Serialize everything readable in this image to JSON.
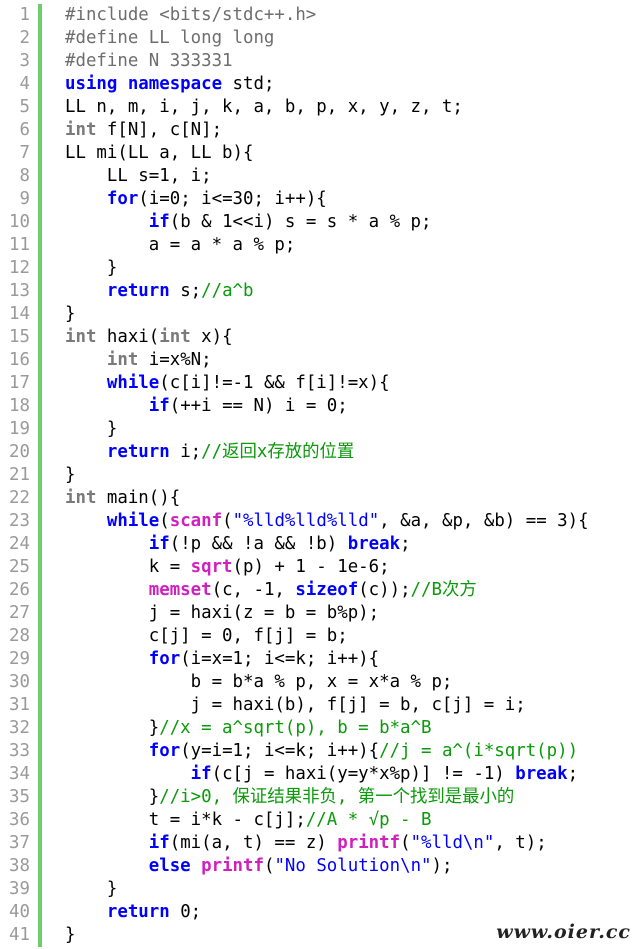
{
  "editor": {
    "lines": [
      {
        "n": "1",
        "segs": [
          {
            "t": "#include <bits/stdc++.h>",
            "c": "pp"
          }
        ]
      },
      {
        "n": "2",
        "segs": [
          {
            "t": "#define LL long long",
            "c": "pp"
          }
        ]
      },
      {
        "n": "3",
        "segs": [
          {
            "t": "#define N 333331",
            "c": "pp"
          }
        ]
      },
      {
        "n": "4",
        "segs": [
          {
            "t": "using namespace ",
            "c": "kw"
          },
          {
            "t": "std;",
            "c": "txt"
          }
        ]
      },
      {
        "n": "5",
        "segs": [
          {
            "t": "LL n, m, i, j, k, a, b, p, x, y, z, t;",
            "c": "txt"
          }
        ]
      },
      {
        "n": "6",
        "segs": [
          {
            "t": "int",
            "c": "ty"
          },
          {
            "t": " f[N], c[N];",
            "c": "txt"
          }
        ]
      },
      {
        "n": "7",
        "segs": [
          {
            "t": "LL mi(LL a, LL b){",
            "c": "txt"
          }
        ]
      },
      {
        "n": "8",
        "segs": [
          {
            "t": "    LL s=1, i;",
            "c": "txt"
          }
        ]
      },
      {
        "n": "9",
        "segs": [
          {
            "t": "    ",
            "c": "txt"
          },
          {
            "t": "for",
            "c": "kw"
          },
          {
            "t": "(i=0; i<=30; i++){",
            "c": "txt"
          }
        ]
      },
      {
        "n": "10",
        "segs": [
          {
            "t": "        ",
            "c": "txt"
          },
          {
            "t": "if",
            "c": "kw"
          },
          {
            "t": "(b & 1<<i) s = s * a % p;",
            "c": "txt"
          }
        ]
      },
      {
        "n": "11",
        "segs": [
          {
            "t": "        a = a * a % p;",
            "c": "txt"
          }
        ]
      },
      {
        "n": "12",
        "segs": [
          {
            "t": "    }",
            "c": "txt"
          }
        ]
      },
      {
        "n": "13",
        "segs": [
          {
            "t": "    ",
            "c": "txt"
          },
          {
            "t": "return",
            "c": "ret"
          },
          {
            "t": " s;",
            "c": "txt"
          },
          {
            "t": "//a^b",
            "c": "cm"
          }
        ]
      },
      {
        "n": "14",
        "segs": [
          {
            "t": "}",
            "c": "txt"
          }
        ]
      },
      {
        "n": "15",
        "segs": [
          {
            "t": "int",
            "c": "ty"
          },
          {
            "t": " haxi(",
            "c": "txt"
          },
          {
            "t": "int",
            "c": "ty"
          },
          {
            "t": " x){",
            "c": "txt"
          }
        ]
      },
      {
        "n": "16",
        "segs": [
          {
            "t": "    ",
            "c": "txt"
          },
          {
            "t": "int",
            "c": "ty"
          },
          {
            "t": " i=x%N;",
            "c": "txt"
          }
        ]
      },
      {
        "n": "17",
        "segs": [
          {
            "t": "    ",
            "c": "txt"
          },
          {
            "t": "while",
            "c": "kw"
          },
          {
            "t": "(c[i]!=-1 && f[i]!=x){",
            "c": "txt"
          }
        ]
      },
      {
        "n": "18",
        "segs": [
          {
            "t": "        ",
            "c": "txt"
          },
          {
            "t": "if",
            "c": "kw"
          },
          {
            "t": "(++i == N) i = 0;",
            "c": "txt"
          }
        ]
      },
      {
        "n": "19",
        "segs": [
          {
            "t": "    }",
            "c": "txt"
          }
        ]
      },
      {
        "n": "20",
        "segs": [
          {
            "t": "    ",
            "c": "txt"
          },
          {
            "t": "return",
            "c": "ret"
          },
          {
            "t": " i;",
            "c": "txt"
          },
          {
            "t": "//返回x存放的位置",
            "c": "cm"
          }
        ]
      },
      {
        "n": "21",
        "segs": [
          {
            "t": "}",
            "c": "txt"
          }
        ]
      },
      {
        "n": "22",
        "segs": [
          {
            "t": "int",
            "c": "ty"
          },
          {
            "t": " main(){",
            "c": "txt"
          }
        ]
      },
      {
        "n": "23",
        "segs": [
          {
            "t": "    ",
            "c": "txt"
          },
          {
            "t": "while",
            "c": "kw"
          },
          {
            "t": "(",
            "c": "txt"
          },
          {
            "t": "scanf",
            "c": "fn"
          },
          {
            "t": "(",
            "c": "txt"
          },
          {
            "t": "\"%lld%lld%lld\"",
            "c": "str"
          },
          {
            "t": ", &a, &p, &b) == 3){",
            "c": "txt"
          }
        ]
      },
      {
        "n": "24",
        "segs": [
          {
            "t": "        ",
            "c": "txt"
          },
          {
            "t": "if",
            "c": "kw"
          },
          {
            "t": "(!p && !a && !b) ",
            "c": "txt"
          },
          {
            "t": "break",
            "c": "brk"
          },
          {
            "t": ";",
            "c": "txt"
          }
        ]
      },
      {
        "n": "25",
        "segs": [
          {
            "t": "        k = ",
            "c": "txt"
          },
          {
            "t": "sqrt",
            "c": "fn"
          },
          {
            "t": "(p) + 1 - 1e-6;",
            "c": "txt"
          }
        ]
      },
      {
        "n": "26",
        "segs": [
          {
            "t": "        ",
            "c": "txt"
          },
          {
            "t": "memset",
            "c": "fn"
          },
          {
            "t": "(c, -1, ",
            "c": "txt"
          },
          {
            "t": "sizeof",
            "c": "kw"
          },
          {
            "t": "(c));",
            "c": "txt"
          },
          {
            "t": "//B次方",
            "c": "cm"
          }
        ]
      },
      {
        "n": "27",
        "segs": [
          {
            "t": "        j = haxi(z = b = b%p);",
            "c": "txt"
          }
        ]
      },
      {
        "n": "28",
        "segs": [
          {
            "t": "        c[j] = 0, f[j] = b;",
            "c": "txt"
          }
        ]
      },
      {
        "n": "29",
        "segs": [
          {
            "t": "        ",
            "c": "txt"
          },
          {
            "t": "for",
            "c": "kw"
          },
          {
            "t": "(i=x=1; i<=k; i++){",
            "c": "txt"
          }
        ]
      },
      {
        "n": "30",
        "segs": [
          {
            "t": "            b = b*a % p, x = x*a % p;",
            "c": "txt"
          }
        ]
      },
      {
        "n": "31",
        "segs": [
          {
            "t": "            j = haxi(b), f[j] = b, c[j] = i;",
            "c": "txt"
          }
        ]
      },
      {
        "n": "32",
        "segs": [
          {
            "t": "        }",
            "c": "txt"
          },
          {
            "t": "//x = a^sqrt(p), b = b*a^B",
            "c": "cm"
          }
        ]
      },
      {
        "n": "33",
        "segs": [
          {
            "t": "        ",
            "c": "txt"
          },
          {
            "t": "for",
            "c": "kw"
          },
          {
            "t": "(y=i=1; i<=k; i++){",
            "c": "txt"
          },
          {
            "t": "//j = a^(i*sqrt(p))",
            "c": "cm"
          }
        ]
      },
      {
        "n": "34",
        "segs": [
          {
            "t": "            ",
            "c": "txt"
          },
          {
            "t": "if",
            "c": "kw"
          },
          {
            "t": "(c[j = haxi(y=y*x%p)] != -1) ",
            "c": "txt"
          },
          {
            "t": "break",
            "c": "brk"
          },
          {
            "t": ";",
            "c": "txt"
          }
        ]
      },
      {
        "n": "35",
        "segs": [
          {
            "t": "        }",
            "c": "txt"
          },
          {
            "t": "//i>0, 保证结果非负, 第一个找到是最小的",
            "c": "cm"
          }
        ]
      },
      {
        "n": "36",
        "segs": [
          {
            "t": "        t = i*k - c[j];",
            "c": "txt"
          },
          {
            "t": "//A * √p - B",
            "c": "cm"
          }
        ]
      },
      {
        "n": "37",
        "segs": [
          {
            "t": "        ",
            "c": "txt"
          },
          {
            "t": "if",
            "c": "kw"
          },
          {
            "t": "(mi(a, t) == z) ",
            "c": "txt"
          },
          {
            "t": "printf",
            "c": "fn"
          },
          {
            "t": "(",
            "c": "txt"
          },
          {
            "t": "\"%lld\\n\"",
            "c": "str"
          },
          {
            "t": ", t);",
            "c": "txt"
          }
        ]
      },
      {
        "n": "38",
        "segs": [
          {
            "t": "        ",
            "c": "txt"
          },
          {
            "t": "else",
            "c": "kw"
          },
          {
            "t": " ",
            "c": "txt"
          },
          {
            "t": "printf",
            "c": "fn"
          },
          {
            "t": "(",
            "c": "txt"
          },
          {
            "t": "\"No Solution\\n\"",
            "c": "str"
          },
          {
            "t": ");",
            "c": "txt"
          }
        ]
      },
      {
        "n": "39",
        "segs": [
          {
            "t": "    }",
            "c": "txt"
          }
        ]
      },
      {
        "n": "40",
        "segs": [
          {
            "t": "    ",
            "c": "txt"
          },
          {
            "t": "return",
            "c": "ret"
          },
          {
            "t": " 0;",
            "c": "txt"
          }
        ]
      },
      {
        "n": "41",
        "segs": [
          {
            "t": "}",
            "c": "txt"
          }
        ]
      }
    ]
  },
  "watermark": "www.oier.cc"
}
